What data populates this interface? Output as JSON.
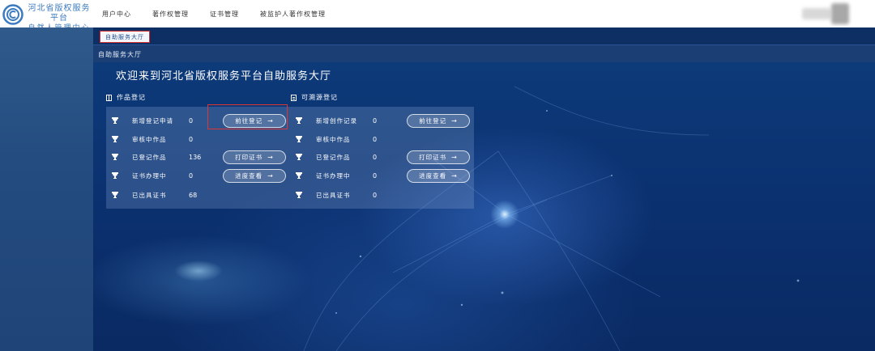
{
  "header": {
    "logo_line1": "河北省版权服务平台",
    "logo_line2": "自然人管理中心",
    "nav": [
      "用户中心",
      "著作权管理",
      "证书管理",
      "被监护人著作权管理"
    ]
  },
  "tabs": [
    {
      "label": "自助服务大厅"
    }
  ],
  "breadcrumb": "自助服务大厅",
  "welcome_title": "欢迎来到河北省版权服务平台自助服务大厅",
  "sections": [
    {
      "title": "作品登记",
      "icon": "book-icon",
      "rows": [
        {
          "label": "新增登记申请",
          "value": "0",
          "button": "前往登记"
        },
        {
          "label": "审核中作品",
          "value": "0",
          "button": ""
        },
        {
          "label": "已登记作品",
          "value": "136",
          "button": "打印证书"
        },
        {
          "label": "证书办理中",
          "value": "0",
          "button": "进度查看"
        },
        {
          "label": "已出具证书",
          "value": "68",
          "button": ""
        }
      ]
    },
    {
      "title": "可溯源登记",
      "icon": "document-icon",
      "rows": [
        {
          "label": "新增创作记录",
          "value": "0",
          "button": "前往登记"
        },
        {
          "label": "审核中作品",
          "value": "0",
          "button": ""
        },
        {
          "label": "已登记作品",
          "value": "0",
          "button": "打印证书"
        },
        {
          "label": "证书办理中",
          "value": "0",
          "button": "进度查看"
        },
        {
          "label": "已出具证书",
          "value": "0",
          "button": ""
        }
      ]
    }
  ],
  "colors": {
    "accent": "#3c7bbf",
    "background": "#0b3170",
    "highlight": "#e03535"
  }
}
